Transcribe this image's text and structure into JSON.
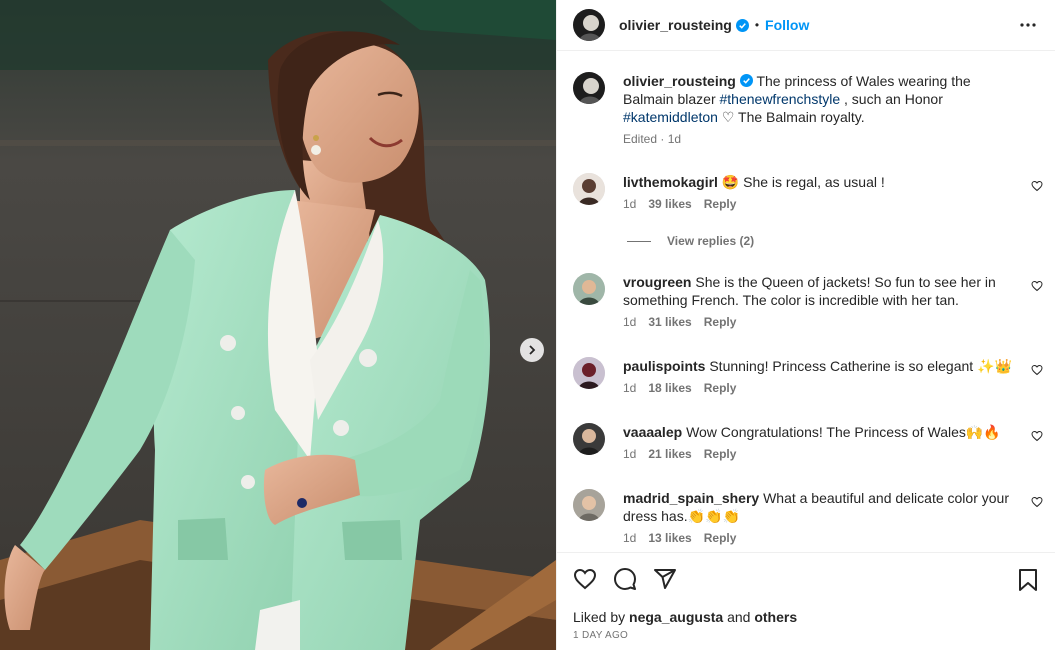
{
  "post": {
    "author": "olivier_rousteing",
    "follow_label": "Follow",
    "dot": "•"
  },
  "caption": {
    "author": "olivier_rousteing",
    "text_a": "The princess of Wales wearing the Balmain blazer ",
    "tag1": "#thenewfrenchstyle",
    "text_b": " , such an Honor ",
    "tag2": "#katemiddleton",
    "text_c": " ♡ The Balmain royalty.",
    "meta": "Edited · 1d"
  },
  "comments": [
    {
      "user": "livthemokagirl",
      "text": "🤩 She is regal, as usual !",
      "time": "1d",
      "likes": "39 likes",
      "reply": "Reply"
    },
    {
      "user": "vrougreen",
      "text": "She is the Queen of jackets! So fun to see her in something French. The color is incredible with her tan.",
      "time": "1d",
      "likes": "31 likes",
      "reply": "Reply"
    },
    {
      "user": "paulispoints",
      "text": "Stunning! Princess Catherine is so elegant ✨👑",
      "time": "1d",
      "likes": "18 likes",
      "reply": "Reply"
    },
    {
      "user": "vaaaalep",
      "text": "Wow Congratulations! The Princess of Wales🙌🔥",
      "time": "1d",
      "likes": "21 likes",
      "reply": "Reply"
    },
    {
      "user": "madrid_spain_shery",
      "text": "What a beautiful and delicate color your dress has.👏👏👏",
      "time": "1d",
      "likes": "13 likes",
      "reply": "Reply"
    }
  ],
  "view_replies": "View replies (2)",
  "footer": {
    "liked_prefix": "Liked by ",
    "liked_user": "nega_augusta",
    "liked_mid": " and ",
    "liked_others": "others",
    "time_ago": "1 DAY AGO"
  },
  "icons": {
    "like": "heart-icon",
    "comment": "comment-icon",
    "share": "share-icon",
    "save": "bookmark-icon",
    "more": "more-icon",
    "next": "chevron-right-icon"
  },
  "colors": {
    "accent": "#0095f6",
    "blazer": "#a8e0c0",
    "hashtag": "#00376b"
  }
}
